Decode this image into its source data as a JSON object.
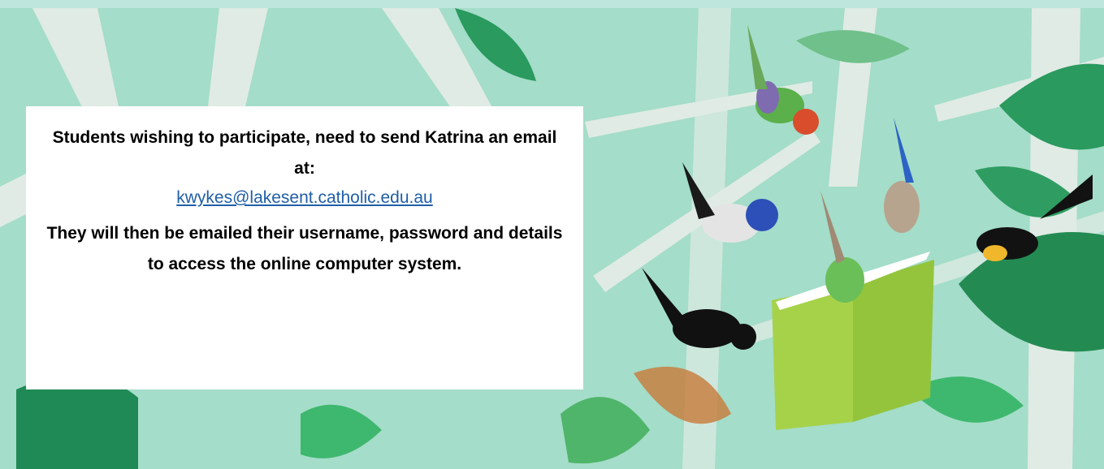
{
  "notice": {
    "intro": "Students wishing to participate, need to send Katrina an email at:",
    "email": "kwykes@lakesent.catholic.edu.au",
    "details": "They will then be emailed their username, password and details to access the online computer system."
  },
  "illustration": {
    "subject": "birds-reading-book",
    "colors": {
      "background": "#a4ddc9",
      "branch": "#e9eee9",
      "leaf_dark": "#1f8a55",
      "leaf_light": "#3fb86f",
      "book": "#a6d24a"
    }
  }
}
